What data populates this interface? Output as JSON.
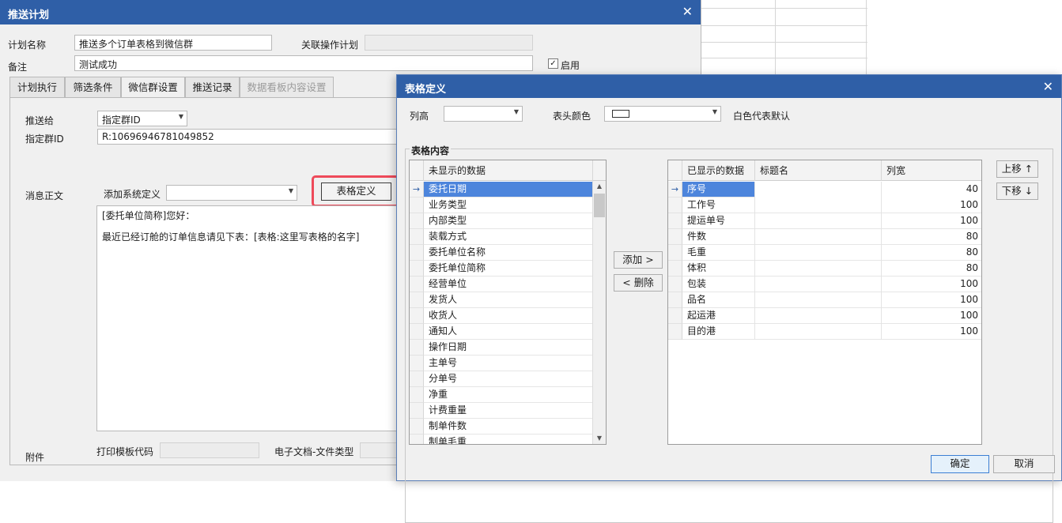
{
  "plan_window": {
    "title": "推送计划",
    "plan_name_label": "计划名称",
    "plan_name_value": "推送多个订单表格到微信群",
    "linked_plan_label": "关联操作计划",
    "linked_plan_value": "",
    "remark_label": "备注",
    "remark_value": "测试成功",
    "enabled_label": "启用",
    "enabled_checked": "✓",
    "tabs": [
      {
        "label": "计划执行"
      },
      {
        "label": "筛选条件"
      },
      {
        "label": "微信群设置"
      },
      {
        "label": "推送记录"
      },
      {
        "label": "数据看板内容设置"
      }
    ],
    "push_to_label": "推送给",
    "push_to_value": "指定群ID",
    "group_id_label": "指定群ID",
    "group_id_value": "R:10696946781049852",
    "message_label": "消息正文",
    "add_system_def_label": "添加系统定义",
    "add_system_def_value": "",
    "table_def_button": "表格定义",
    "message_lines": [
      "[委托单位简称]您好：",
      "",
      "最近已经订舱的订单信息请见下表：[表格:这里写表格的名字]"
    ],
    "attachment_label": "附件",
    "print_template_label": "打印模板代码",
    "print_template_value": "",
    "e_doc_label": "电子文档-文件类型"
  },
  "table_dialog": {
    "title": "表格定义",
    "row_height_label": "列高",
    "row_height_value": "",
    "header_color_label": "表头颜色",
    "header_color_hint": "白色代表默认",
    "header_color_value": "#ffffff",
    "group_title": "表格内容",
    "hidden_header": "未显示的数据",
    "hidden_items": [
      "委托日期",
      "业务类型",
      "内部类型",
      "装载方式",
      "委托单位名称",
      "委托单位简称",
      "经营单位",
      "发货人",
      "收货人",
      "通知人",
      "操作日期",
      "主单号",
      "分单号",
      "净重",
      "计费重量",
      "制单件数",
      "制单毛重"
    ],
    "add_button": "添加 >",
    "remove_button": "< 删除",
    "shown_headers": {
      "data": "已显示的数据",
      "title": "标题名",
      "width": "列宽"
    },
    "shown_items": [
      {
        "data": "序号",
        "title": "",
        "width": "40"
      },
      {
        "data": "工作号",
        "title": "",
        "width": "100"
      },
      {
        "data": "提运单号",
        "title": "",
        "width": "100"
      },
      {
        "data": "件数",
        "title": "",
        "width": "80"
      },
      {
        "data": "毛重",
        "title": "",
        "width": "80"
      },
      {
        "data": "体积",
        "title": "",
        "width": "80"
      },
      {
        "data": "包装",
        "title": "",
        "width": "100"
      },
      {
        "data": "品名",
        "title": "",
        "width": "100"
      },
      {
        "data": "起运港",
        "title": "",
        "width": "100"
      },
      {
        "data": "目的港",
        "title": "",
        "width": "100"
      }
    ],
    "move_up_button": "上移 ↑",
    "move_down_button": "下移 ↓",
    "ok_button": "确定",
    "cancel_button": "取消"
  },
  "colors": {
    "title_bar": "#2f5fa7",
    "selection": "#4d85dc",
    "highlight_border": "#ee4a5a"
  }
}
